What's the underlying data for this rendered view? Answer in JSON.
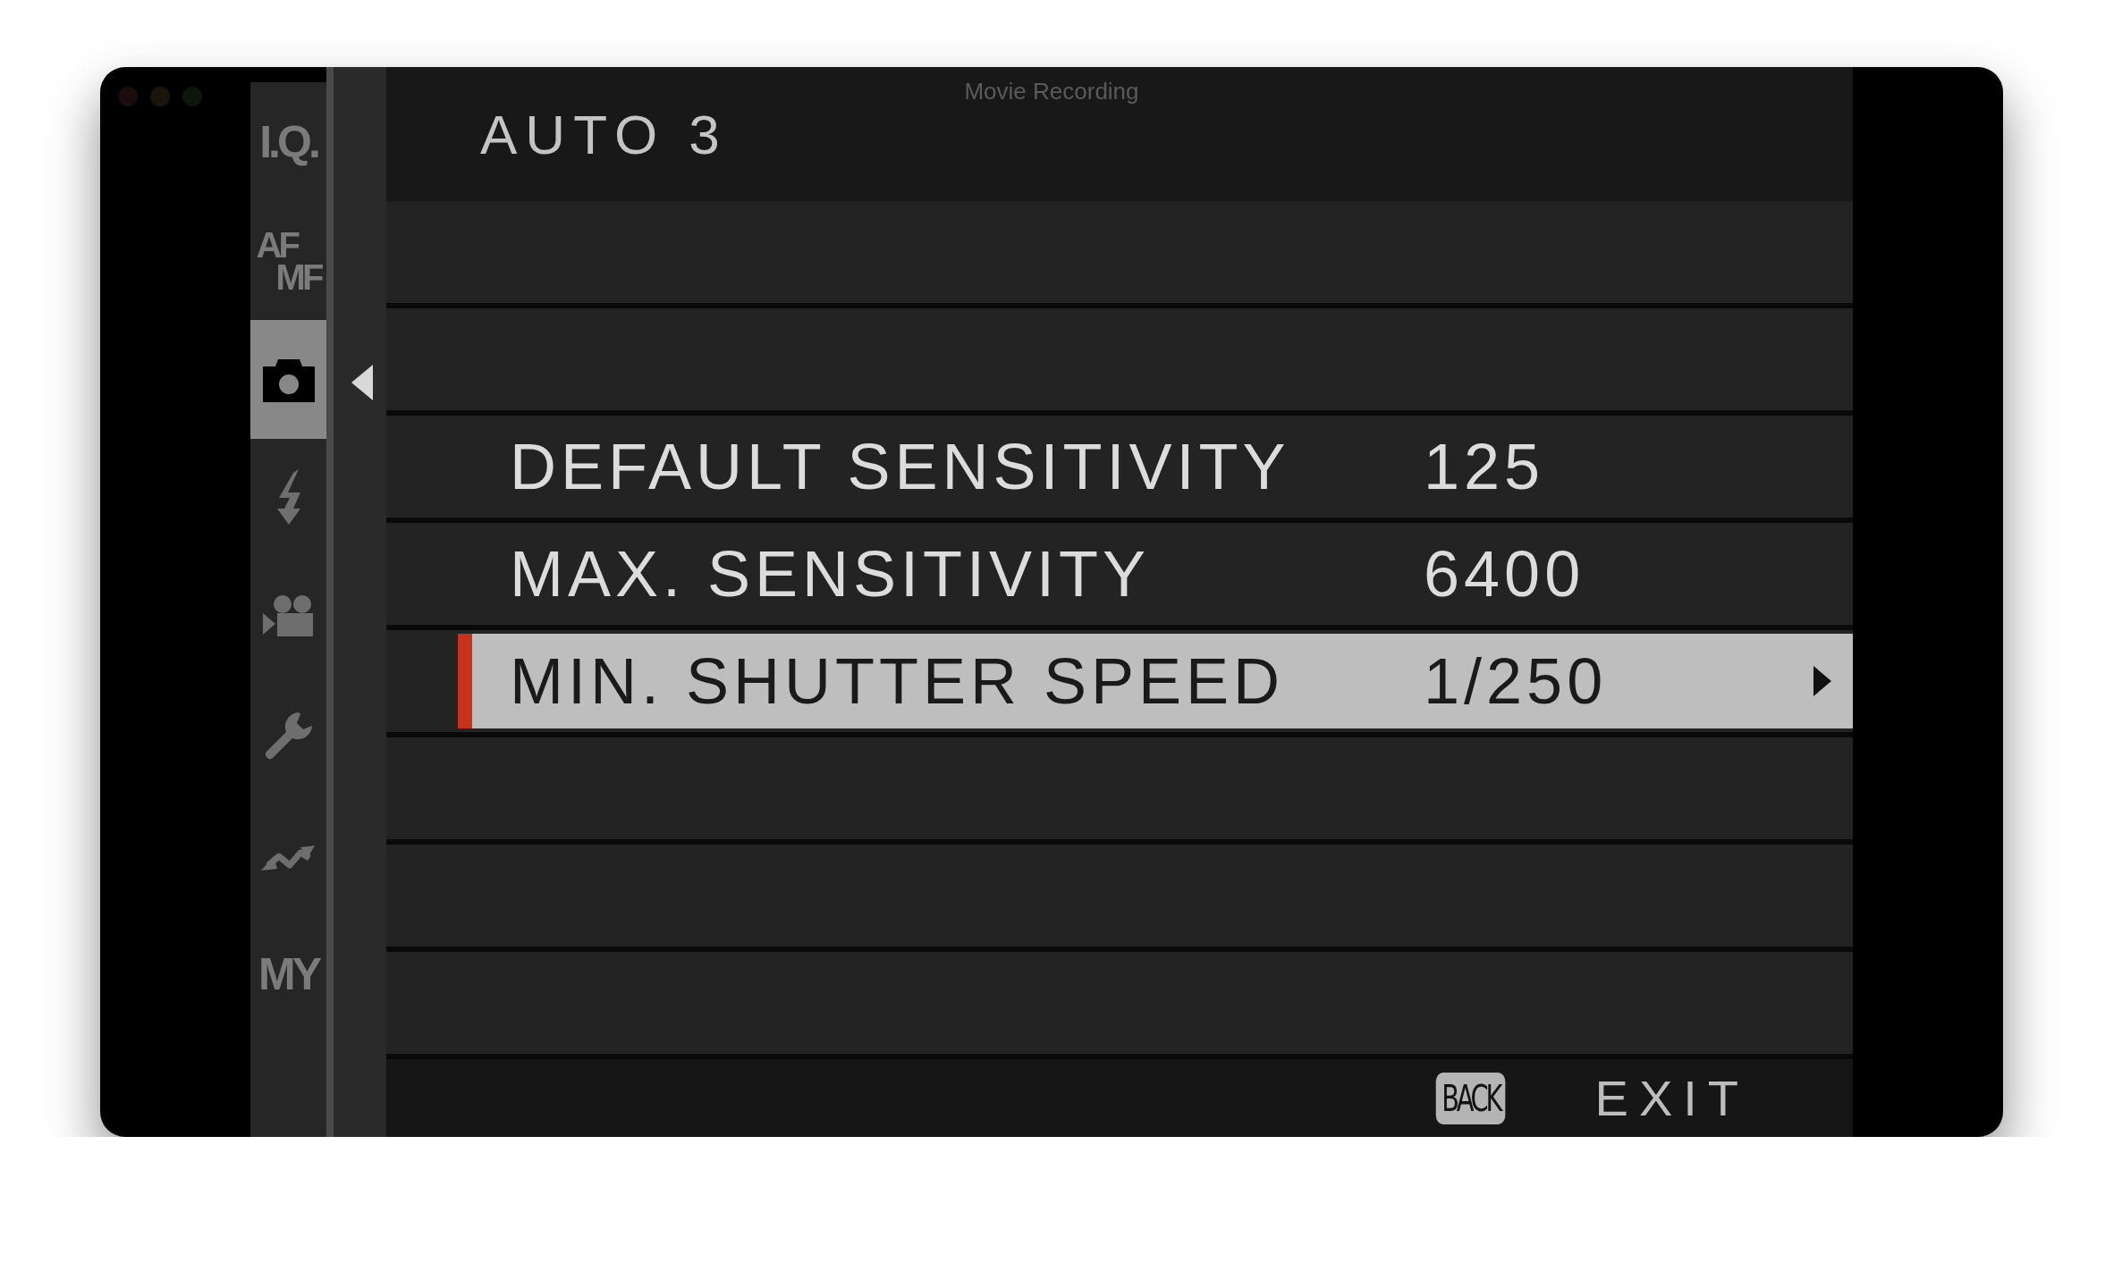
{
  "window": {
    "title": "Movie Recording"
  },
  "sidebar": {
    "items": [
      {
        "kind": "text",
        "lines": [
          "I.Q."
        ],
        "selected": false
      },
      {
        "kind": "text",
        "lines": [
          "AF",
          "MF"
        ],
        "selected": false
      },
      {
        "kind": "camera",
        "selected": true
      },
      {
        "kind": "flash",
        "selected": false
      },
      {
        "kind": "movie",
        "selected": false
      },
      {
        "kind": "wrench",
        "selected": false
      },
      {
        "kind": "wireless",
        "selected": false
      },
      {
        "kind": "text",
        "lines": [
          "MY"
        ],
        "selected": false
      }
    ]
  },
  "menu": {
    "title": "AUTO 3",
    "rows": [
      {
        "kind": "empty"
      },
      {
        "kind": "empty"
      },
      {
        "kind": "setting",
        "label": "DEFAULT SENSITIVITY",
        "value": "125",
        "selected": false,
        "submenu": false
      },
      {
        "kind": "setting",
        "label": "MAX. SENSITIVITY",
        "value": "6400",
        "selected": false,
        "submenu": false
      },
      {
        "kind": "setting",
        "label": "MIN. SHUTTER SPEED",
        "value": "1/250",
        "selected": true,
        "submenu": true
      },
      {
        "kind": "empty"
      },
      {
        "kind": "empty"
      },
      {
        "kind": "empty"
      }
    ]
  },
  "footer": {
    "back_key": "BACK",
    "exit": "EXIT"
  }
}
